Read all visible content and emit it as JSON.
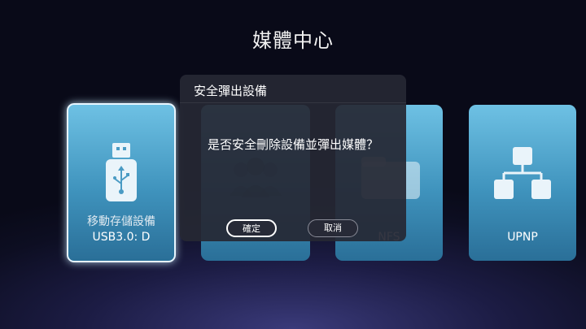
{
  "page": {
    "title": "媒體中心"
  },
  "sources": [
    {
      "line1": "移動存儲設備",
      "line2": "USB3.0: D",
      "icon": "usb-drive-icon",
      "selected": true
    },
    {
      "label": "",
      "icon": "network-users-icon"
    },
    {
      "label": "NFS",
      "icon": "nfs-folder-icon"
    },
    {
      "label": "UPNP",
      "icon": "upnp-network-icon"
    }
  ],
  "dialog": {
    "title": "安全彈出設備",
    "message": "是否安全刪除設備並彈出媒體？",
    "ok_label": "確定",
    "cancel_label": "取消"
  },
  "colors": {
    "card_top": "#6ec1e4",
    "card_bottom": "#2a6f98",
    "dialog_bg": "#262834"
  }
}
